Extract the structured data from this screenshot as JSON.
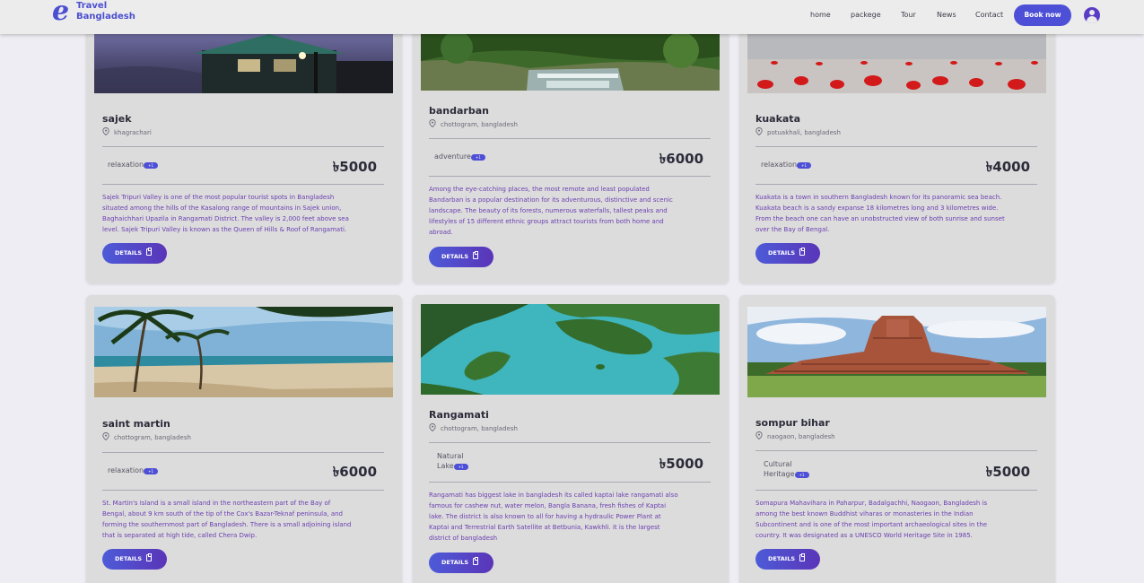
{
  "nav": {
    "logo_glyph": "e",
    "logo_line1": "Travel",
    "logo_line2": "Bangladesh",
    "links": [
      "home",
      "packege",
      "Tour",
      "News",
      "Contact"
    ],
    "book_label": "Book now",
    "accent": "#4d4fd6"
  },
  "cards": [
    {
      "title": "sajek",
      "location": "khagrachari",
      "category": "relaxation",
      "badge": "+1",
      "price": "৳5000",
      "description": "Sajek Tripuri Valley is one of the most popular tourist spots in Bangladesh situated among the hills of the Kasalong range of mountains in Sajek union, Baghaichhari Upazila in Rangamati District. The valley is 2,000 feet above sea level. Sajek Tripuri Valley is known as the Queen of Hills & Roof of Rangamati.",
      "button": "DETAILS",
      "image": "hill-resort-night-photo"
    },
    {
      "title": "bandarban",
      "location": "chottogram, bangladesh",
      "category": "adventure",
      "badge": "+1",
      "price": "৳6000",
      "description": "Among the eye-catching places, the most remote and least populated Bandarban is a popular destination for its adventurous, distinctive and scenic landscape. The beauty of its forests, numerous waterfalls, tallest peaks and lifestyles of 15 different ethnic groups attract tourists from both home and abroad.",
      "button": "DETAILS",
      "image": "forest-waterfall-photo"
    },
    {
      "title": "kuakata",
      "location": "potuakhali, bangladesh",
      "category": "relaxation",
      "badge": "+1",
      "price": "৳4000",
      "description": "Kuakata is a town in southern Bangladesh known for its panoramic sea beach. Kuakata beach is a sandy expanse 18 kilometres long and 3 kilometres wide. From the beach one can have an unobstructed view of both sunrise and sunset over the Bay of Bengal.",
      "button": "DETAILS",
      "image": "red-crabs-beach-photo"
    },
    {
      "title": "saint martin",
      "location": "chottogram, bangladesh",
      "category": "relaxation",
      "badge": "+1",
      "price": "৳6000",
      "description": "St. Martin's Island is a small island in the northeastern part of the Bay of Bengal, about 9 km south of the tip of the Cox's Bazar-Teknaf peninsula, and forming the southernmost part of Bangladesh. There is a small adjoining island that is separated at high tide, called Chera Dwip.",
      "button": "DETAILS",
      "image": "palm-beach-photo"
    },
    {
      "title": "Rangamati",
      "location": "chottogram, bangladesh",
      "category": "Natural Lake",
      "badge": "+1",
      "price": "৳5000",
      "description": "Rangamati has biggest lake in bangladesh its called kaptai lake rangamati also famous for cashew nut, water melon, Bangla Banana, fresh fishes of Kaptai lake. The district is also known to all for having a hydraulic Power Plant at Kaptai and Terrestrial Earth Satellite at Betbunia, Kawkhli. it is the largest district of bangladesh",
      "button": "DETAILS",
      "image": "lake-islands-aerial-photo"
    },
    {
      "title": "sompur bihar",
      "location": "naogaon, bangladesh",
      "category": "Cultural Heritage",
      "badge": "+1",
      "price": "৳5000",
      "description": "Somapura Mahavihara in Paharpur, Badalgachhi, Naogaon, Bangladesh is among the best known Buddhist viharas or monasteries in the Indian Subcontinent and is one of the most important archaeological sites in the country. It was designated as a UNESCO World Heritage Site in 1985.",
      "button": "DETAILS",
      "image": "brick-monastery-ruins-photo"
    }
  ]
}
